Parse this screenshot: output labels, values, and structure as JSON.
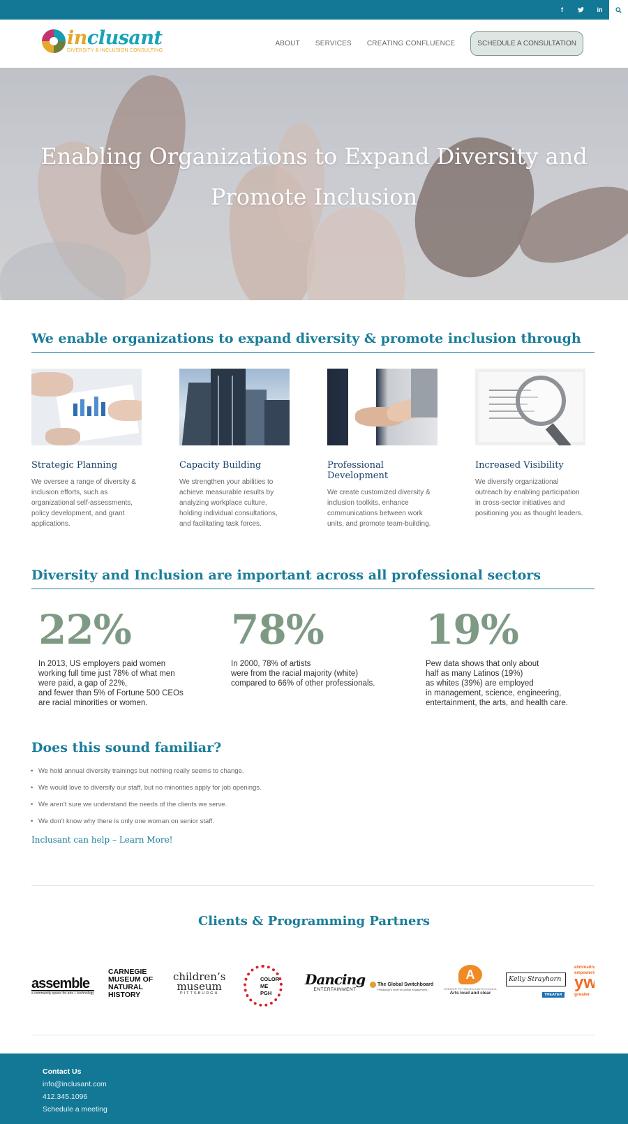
{
  "topbar": {
    "social": [
      {
        "icon": "facebook-icon",
        "glyph": "f"
      },
      {
        "icon": "twitter-icon",
        "glyph": "t"
      },
      {
        "icon": "linkedin-icon",
        "glyph": "in"
      }
    ],
    "search_icon": "search-icon",
    "color": "#137896"
  },
  "header": {
    "logo_word_in": "in",
    "logo_word_rest": "clusant",
    "logo_tagline": "DIVERSITY & INCLUSION CONSULTING",
    "nav": [
      "ABOUT",
      "SERVICES",
      "CREATING CONFLUENCE"
    ],
    "cta": "SCHEDULE A CONSULTATION"
  },
  "hero": {
    "line1": "Enabling Organizations to Expand Diversity and",
    "line2": "Promote Inclusion"
  },
  "services": {
    "heading": "We enable organizations to expand diversity & promote inclusion through",
    "cards": [
      {
        "title": "Strategic Planning",
        "desc": "We oversee a range of diversity & inclusion efforts, such as organizational self-assessments, policy development, and grant applications."
      },
      {
        "title": "Capacity Building",
        "desc": "We strengthen your abilities to achieve measurable results by analyzing workplace culture, holding individual consultations, and facilitating task forces."
      },
      {
        "title": "Professional Development",
        "desc": "We create customized diversity & inclusion toolkits, enhance communications between work units, and promote team-building."
      },
      {
        "title": "Increased Visibility",
        "desc": "We diversify organizational outreach by enabling participation in cross-sector  initiatives and positioning you as thought leaders."
      }
    ]
  },
  "stats": {
    "heading": "Diversity and Inclusion are important across all professional sectors",
    "items": [
      {
        "number": "22%",
        "text": "In 2013, US employers paid women\nworking full time just 78% of what men\nwere paid, a gap of 22%,\nand fewer than 5% of Fortune 500 CEOs\nare racial minorities or women."
      },
      {
        "number": "78%",
        "text": "In 2000, 78% of artists\nwere from the racial majority (white)\ncompared to 66% of other professionals."
      },
      {
        "number": "19%",
        "text": "Pew data shows that only about\nhalf as many Latinos (19%)\nas whites (39%) are employed\nin management, science, engineering,\nentertainment, the arts, and health care."
      }
    ]
  },
  "familiar": {
    "heading": "Does this sound familiar?",
    "bullets": [
      "We hold annual diversity trainings but nothing really seems to change.",
      "We would love to diversify our staff, but no minorities apply for job openings.",
      "We aren’t sure we understand the needs of the clients we serve.",
      "We don’t know why there is only one woman on senior staff."
    ],
    "link": "Inclusant can help – Learn More!"
  },
  "partners": {
    "heading": "Clients & Programming Partners",
    "logos": [
      {
        "name": "assemble",
        "sub": "a community space for arts + technology"
      },
      {
        "name": "CARNEGIE\nMUSEUM OF\nNATURAL\nHISTORY"
      },
      {
        "name": "children’s\nmuseum",
        "sub": "PITTSBURGH"
      },
      {
        "name": "COLOR\nME\nPGH"
      },
      {
        "name": "Dancing",
        "sub": "ENTERTAINMENT"
      },
      {
        "name": "The Global Switchboard",
        "sub": "Pittsburgh's hotel for global engagement"
      },
      {
        "name": "A",
        "sub": "GREATER PITTSBURGH ARTS COUNCIL",
        "sub2": "Arts loud and clear"
      },
      {
        "name": "Kelly Strayhorn",
        "sub": "THEATER"
      },
      {
        "name": "yw",
        "sub": "eliminating\nempowering",
        "sub2": "greater"
      }
    ]
  },
  "footer": {
    "heading": "Contact Us",
    "email": "info@inclusant.com",
    "phone": "412.345.1096",
    "schedule": "Schedule a meeting"
  }
}
